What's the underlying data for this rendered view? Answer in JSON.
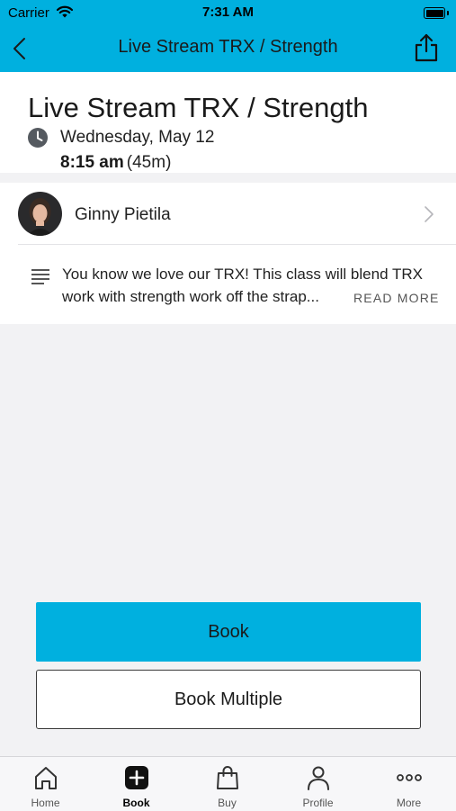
{
  "status_bar": {
    "carrier": "Carrier",
    "time": "7:31 AM"
  },
  "nav": {
    "title": "Live Stream TRX / Strength",
    "back_icon": "chevron-left-icon",
    "share_icon": "share-icon"
  },
  "class_info": {
    "title": "Live Stream TRX / Strength",
    "date": "Wednesday, May 12",
    "start_time": "8:15 am",
    "duration": "(45m)"
  },
  "instructor": {
    "name": "Ginny Pietila"
  },
  "description": {
    "line1": "You know we love our TRX!  This class will blend TRX",
    "line2": "work with strength work off the strap...",
    "read_more": "READ MORE"
  },
  "actions": {
    "book_label": "Book",
    "book_multiple_label": "Book Multiple"
  },
  "tabs": [
    {
      "label": "Home",
      "icon": "home-icon",
      "active": false
    },
    {
      "label": "Book",
      "icon": "plus-square-icon",
      "active": true
    },
    {
      "label": "Buy",
      "icon": "shopping-bag-icon",
      "active": false
    },
    {
      "label": "Profile",
      "icon": "person-icon",
      "active": false
    },
    {
      "label": "More",
      "icon": "more-dots-icon",
      "active": false
    }
  ],
  "colors": {
    "accent": "#00b0df",
    "background": "#f2f2f4",
    "card": "#ffffff"
  }
}
